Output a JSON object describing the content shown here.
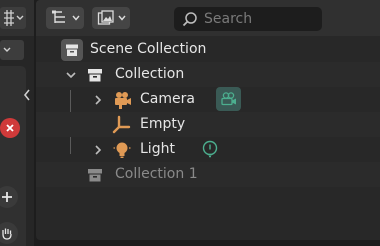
{
  "colors": {
    "object_orange": "#e09a55",
    "data_green": "#4caf8f",
    "active_highlight": "#3a5a55",
    "delete_red": "#cf3a3a"
  },
  "outliner": {
    "header": {
      "display_mode_icon": "outliner-hierarchy-icon",
      "filter_icon": "filter-icon",
      "search_placeholder": "Search"
    },
    "scene_collection": {
      "label": "Scene Collection",
      "icon": "collection-icon"
    },
    "collections": [
      {
        "label": "Collection",
        "expanded": true,
        "children": [
          {
            "label": "Camera",
            "icon": "camera-object-icon",
            "data_icon": "camera-data-icon",
            "expandable": true
          },
          {
            "label": "Empty",
            "icon": "empty-object-icon",
            "expandable": false
          },
          {
            "label": "Light",
            "icon": "light-object-icon",
            "data_icon": "light-data-icon",
            "expandable": true
          }
        ]
      },
      {
        "label": "Collection 1",
        "excluded": true
      }
    ]
  }
}
